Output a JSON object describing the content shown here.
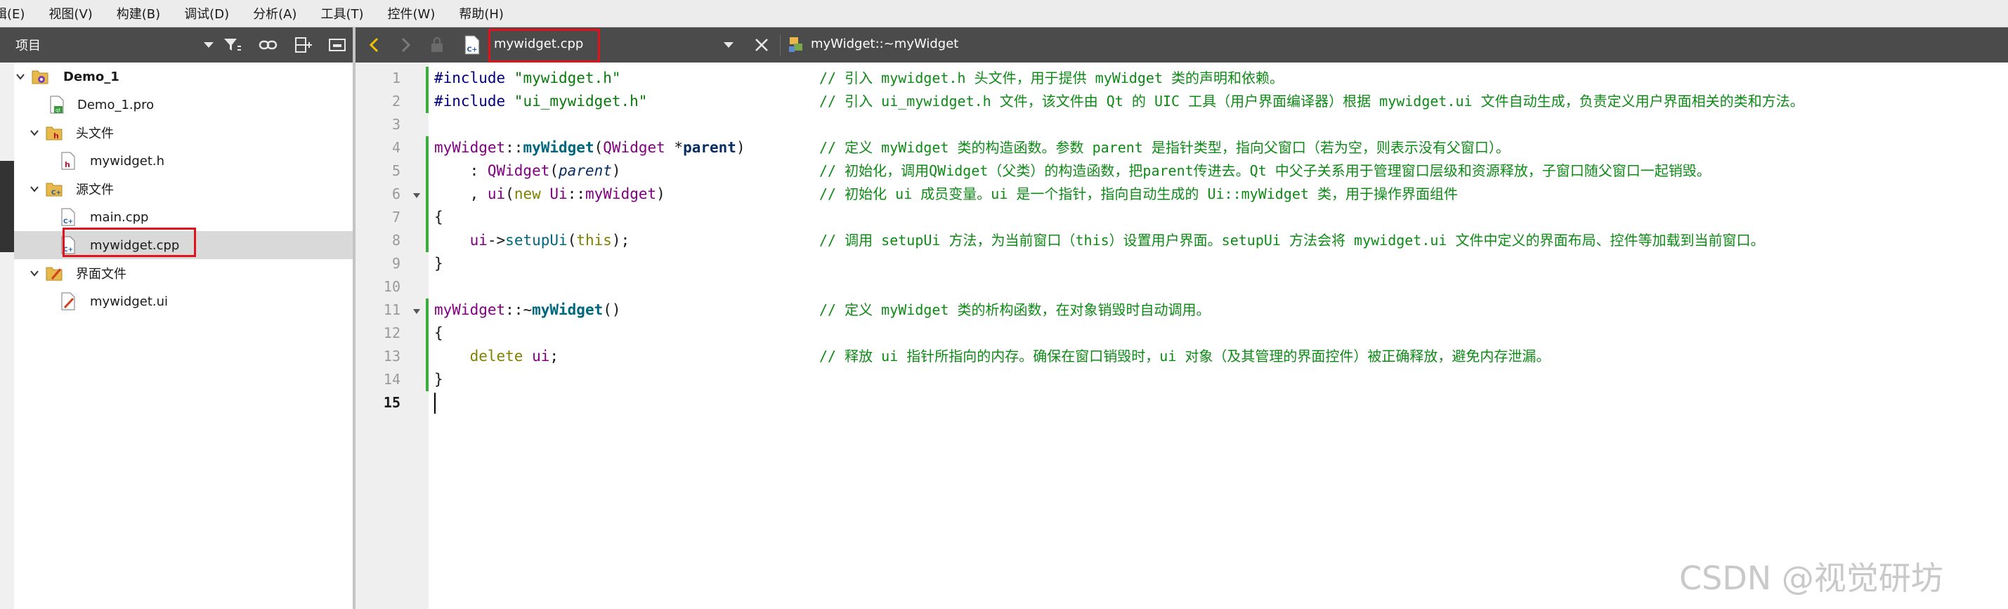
{
  "menubar": {
    "items": [
      "辑(E)",
      "视图(V)",
      "构建(B)",
      "调试(D)",
      "分析(A)",
      "工具(T)",
      "控件(W)",
      "帮助(H)"
    ]
  },
  "sidebar": {
    "project_select": "项目",
    "tree": [
      {
        "label": "Demo_1",
        "icon": "qt-project-icon"
      },
      {
        "label": "Demo_1.pro",
        "icon": "pro-file-icon"
      },
      {
        "label": "头文件",
        "icon": "header-folder-icon"
      },
      {
        "label": "mywidget.h",
        "icon": "header-file-icon"
      },
      {
        "label": "源文件",
        "icon": "source-folder-icon"
      },
      {
        "label": "main.cpp",
        "icon": "cpp-file-icon"
      },
      {
        "label": "mywidget.cpp",
        "icon": "cpp-file-icon"
      },
      {
        "label": "界面文件",
        "icon": "forms-folder-icon"
      },
      {
        "label": "mywidget.ui",
        "icon": "ui-file-icon"
      }
    ]
  },
  "editor": {
    "file_tab": "mywidget.cpp",
    "symbol": "myWidget::~myWidget",
    "line_numbers": [
      "1",
      "2",
      "3",
      "4",
      "5",
      "6",
      "7",
      "8",
      "9",
      "10",
      "11",
      "12",
      "13",
      "14",
      "15"
    ],
    "code": {
      "l1": {
        "a": "#include",
        "b": " \"mywidget.h\""
      },
      "l2": {
        "a": "#include",
        "b": " \"ui_mywidget.h\""
      },
      "l4": {
        "a": "myWidget",
        "b": "::",
        "c": "myWidget",
        "d": "(",
        "e": "QWidget",
        "f": " *",
        "g": "parent",
        "h": ")"
      },
      "l5": {
        "a": "    : ",
        "b": "QWidget",
        "c": "(",
        "d": "parent",
        "e": ")"
      },
      "l6": {
        "a": "    , ",
        "b": "ui",
        "c": "(",
        "d": "new",
        "e": " ",
        "f": "Ui",
        "g": "::",
        "h": "myWidget",
        "i": ")"
      },
      "l7": {
        "a": "{"
      },
      "l8": {
        "a": "    ",
        "b": "ui",
        "c": "->",
        "d": "setupUi",
        "e": "(",
        "f": "this",
        "g": ");"
      },
      "l9": {
        "a": "}"
      },
      "l11": {
        "a": "myWidget",
        "b": "::~",
        "c": "myWidget",
        "d": "()"
      },
      "l12": {
        "a": "{"
      },
      "l13": {
        "a": "    ",
        "b": "delete",
        "c": " ",
        "d": "ui",
        "e": ";"
      },
      "l14": {
        "a": "}"
      }
    },
    "comments": {
      "l1": "// 引入 mywidget.h 头文件，用于提供 myWidget 类的声明和依赖。",
      "l2": "// 引入 ui_mywidget.h 文件，该文件由 Qt 的 UIC 工具（用户界面编译器）根据 mywidget.ui 文件自动生成，负责定义用户界面相关的类和方法。",
      "l4": "// 定义 myWidget 类的构造函数。参数 parent 是指针类型，指向父窗口（若为空，则表示没有父窗口）。",
      "l5": "// 初始化，调用QWidget（父类）的构造函数，把parent传进去。Qt 中父子关系用于管理窗口层级和资源释放，子窗口随父窗口一起销毁。",
      "l6": "// 初始化 ui 成员变量。ui 是一个指针，指向自动生成的 Ui::myWidget 类，用于操作界面组件",
      "l8": "// 调用 setupUi 方法，为当前窗口（this）设置用户界面。setupUi 方法会将 mywidget.ui 文件中定义的界面布局、控件等加载到当前窗口。",
      "l11": "// 定义 myWidget 类的析构函数，在对象销毁时自动调用。",
      "l13": "// 释放 ui 指针所指向的内存。确保在窗口销毁时，ui 对象（及其管理的界面控件）被正确释放，避免内存泄漏。"
    }
  },
  "watermark": "CSDN @视觉研坊",
  "colors": {
    "highlight_box": "#e0121b",
    "change_bar": "#3cad3c",
    "comment": "#0e8a16",
    "toolbar": "#4b4b4b"
  }
}
